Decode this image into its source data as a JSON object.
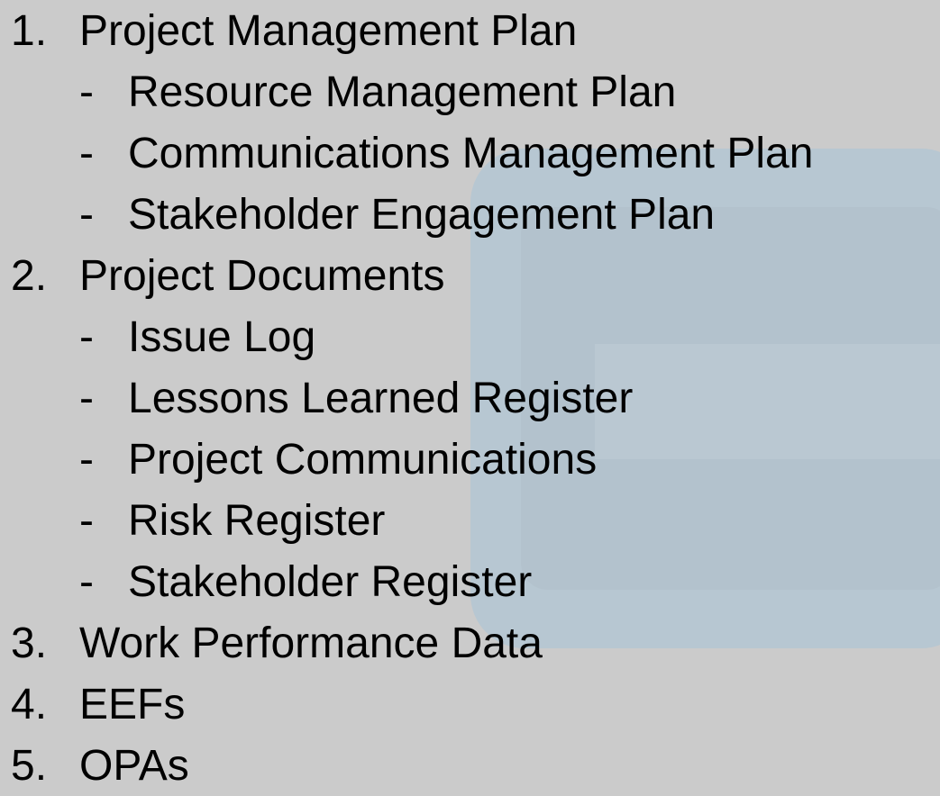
{
  "items": [
    {
      "number": "1.",
      "label": "Project Management Plan",
      "subitems": [
        {
          "bullet": "-",
          "label": "Resource Management Plan"
        },
        {
          "bullet": "-",
          "label": "Communications Management Plan"
        },
        {
          "bullet": "-",
          "label": "Stakeholder Engagement Plan"
        }
      ]
    },
    {
      "number": "2.",
      "label": "Project Documents",
      "subitems": [
        {
          "bullet": "-",
          "label": "Issue Log"
        },
        {
          "bullet": "-",
          "label": "Lessons Learned Register"
        },
        {
          "bullet": "-",
          "label": "Project Communications"
        },
        {
          "bullet": "-",
          "label": "Risk Register"
        },
        {
          "bullet": "-",
          "label": "Stakeholder Register"
        }
      ]
    },
    {
      "number": "3.",
      "label": "Work Performance Data",
      "subitems": []
    },
    {
      "number": "4.",
      "label": "EEFs",
      "subitems": []
    },
    {
      "number": "5.",
      "label": "OPAs",
      "subitems": []
    }
  ],
  "colors": {
    "background": "#cbcbcb",
    "accent_shape": "#b7c7d2",
    "text": "#000000"
  }
}
